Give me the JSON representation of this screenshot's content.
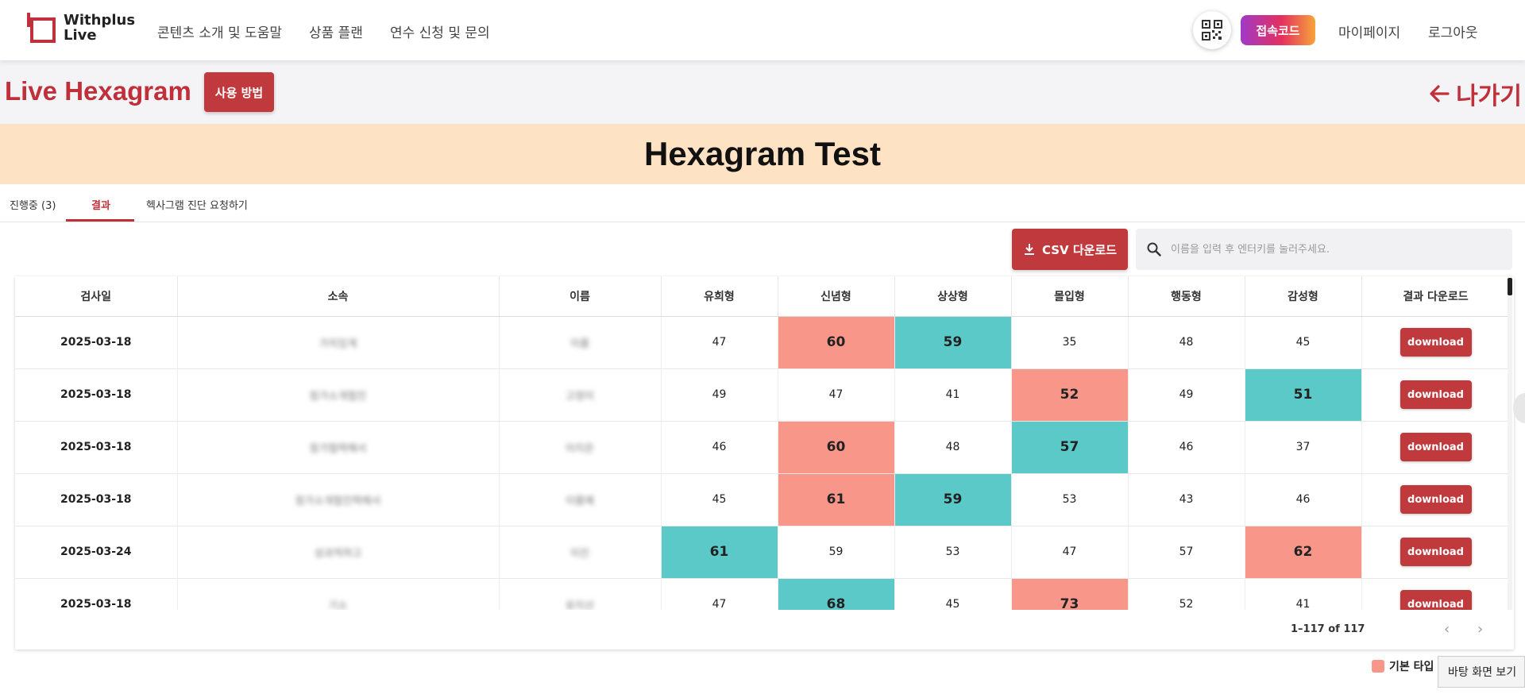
{
  "nav": {
    "logo_line1": "Withplus",
    "logo_line2": "Live",
    "links": [
      "콘텐츠 소개 및 도움말",
      "상품 플랜",
      "연수 신청 및 문의"
    ],
    "code_button": "접속코드",
    "mypage": "마이페이지",
    "logout": "로그아웃"
  },
  "header": {
    "title": "Live Hexagram",
    "howto_button": "사용 방법",
    "exit_label": "나가기"
  },
  "banner": {
    "title": "Hexagram Test"
  },
  "tabs": [
    {
      "label": "진행중 (3)",
      "active": false
    },
    {
      "label": "결과",
      "active": true
    },
    {
      "label": "헥사그램 진단 요청하기",
      "active": false
    }
  ],
  "toolbar": {
    "csv_button": "CSV 다운로드",
    "search_placeholder": "이름을 입력 후 엔터키를 눌러주세요."
  },
  "table": {
    "headers": [
      "검사일",
      "소속",
      "이름",
      "유희형",
      "신념형",
      "상상형",
      "몰입형",
      "행동형",
      "감성형",
      "결과 다운로드"
    ],
    "rows": [
      {
        "date": "2025-03-18",
        "affiliation": "가치있게",
        "name": "이름",
        "scores": [
          "47",
          "60",
          "59",
          "35",
          "48",
          "45"
        ],
        "hi": [
          "",
          "red",
          "teal",
          "",
          "",
          ""
        ],
        "download": "download"
      },
      {
        "date": "2025-03-18",
        "affiliation": "참가소개협진",
        "name": "고정이",
        "scores": [
          "49",
          "47",
          "41",
          "52",
          "49",
          "51"
        ],
        "hi": [
          "",
          "",
          "",
          "red",
          "",
          "teal"
        ],
        "download": "download"
      },
      {
        "date": "2025-03-18",
        "affiliation": "참가협력해서",
        "name": "이지은",
        "scores": [
          "46",
          "60",
          "48",
          "57",
          "46",
          "37"
        ],
        "hi": [
          "",
          "red",
          "",
          "teal",
          "",
          ""
        ],
        "download": "download"
      },
      {
        "date": "2025-03-18",
        "affiliation": "참가소개협진력해서",
        "name": "이름예",
        "scores": [
          "45",
          "61",
          "59",
          "53",
          "43",
          "46"
        ],
        "hi": [
          "",
          "red",
          "teal",
          "",
          "",
          ""
        ],
        "download": "download"
      },
      {
        "date": "2025-03-24",
        "affiliation": "성과적하고",
        "name": "이진",
        "scores": [
          "61",
          "59",
          "53",
          "47",
          "57",
          "62"
        ],
        "hi": [
          "teal",
          "",
          "",
          "",
          "",
          "red"
        ],
        "download": "download"
      },
      {
        "date": "2025-03-18",
        "affiliation": "기소",
        "name": "유지선",
        "scores": [
          "47",
          "68",
          "45",
          "73",
          "52",
          "41"
        ],
        "hi": [
          "",
          "teal",
          "",
          "red",
          "",
          ""
        ],
        "download": "download"
      }
    ]
  },
  "pager": {
    "text": "1–117 of 117"
  },
  "legend": {
    "label": "기본 타입",
    "color": "#f9968a"
  },
  "desktop_overlay": "바탕 화면 보기"
}
